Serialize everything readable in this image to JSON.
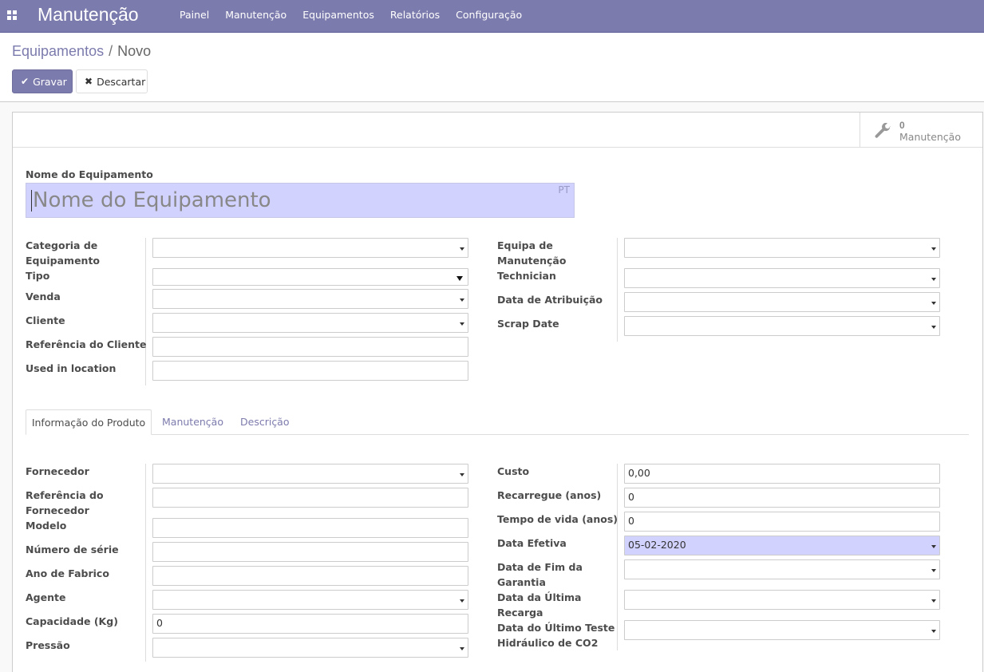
{
  "navbar": {
    "brand": "Manutenção",
    "menu": [
      "Painel",
      "Manutenção",
      "Equipamentos",
      "Relatórios",
      "Configuração"
    ]
  },
  "breadcrumb": {
    "parent": "Equipamentos",
    "separator": "/",
    "current": "Novo"
  },
  "buttons": {
    "save": "Gravar",
    "discard": "Descartar"
  },
  "stat_button": {
    "count": "0",
    "label": "Manutenção"
  },
  "form": {
    "name_label": "Nome do Equipamento",
    "name_placeholder": "Nome do Equipamento",
    "lang_badge": "PT",
    "left_fields": {
      "category": "Categoria de Equipamento",
      "type": "Tipo",
      "sale": "Venda",
      "customer": "Cliente",
      "customer_ref": "Referência do Cliente",
      "location": "Used in location"
    },
    "right_fields": {
      "team": "Equipa de Manutenção",
      "technician": "Technician",
      "assign_date": "Data de Atribuição",
      "scrap_date": "Scrap Date"
    }
  },
  "tabs": [
    "Informação do Produto",
    "Manutenção",
    "Descrição"
  ],
  "product_info": {
    "left": {
      "vendor": "Fornecedor",
      "vendor_ref": "Referência do Fornecedor",
      "model": "Modelo",
      "serial": "Número de série",
      "year": "Ano de Fabrico",
      "agent": "Agente",
      "capacity": "Capacidade (Kg)",
      "capacity_value": "0",
      "pressure": "Pressão"
    },
    "right": {
      "cost": "Custo",
      "cost_value": "0,00",
      "recharge": "Recarregue (anos)",
      "recharge_value": "0",
      "lifetime": "Tempo de vida (anos)",
      "lifetime_value": "0",
      "effective_date": "Data Efetiva",
      "effective_date_value": "05-02-2020",
      "warranty_end": "Data de Fim da Garantia",
      "last_recharge": "Data da Última Recarga",
      "last_test": "Data do Último Teste Hidráulico de CO2"
    }
  }
}
